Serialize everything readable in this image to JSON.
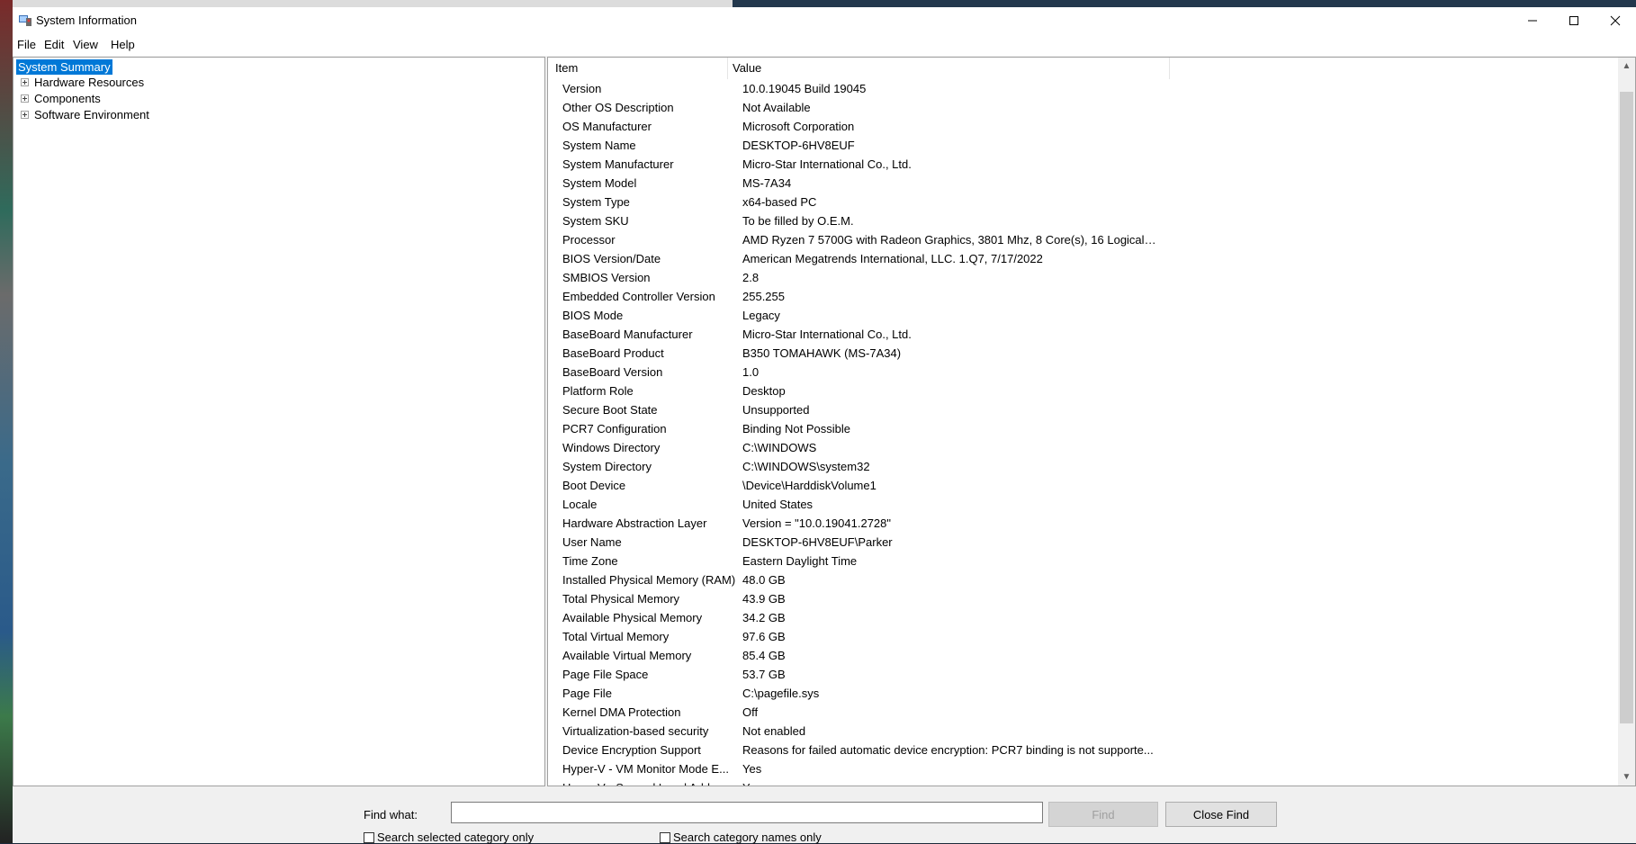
{
  "window": {
    "title": "System Information",
    "app_icon": "system-information-icon",
    "controls": [
      "minimize-icon",
      "maximize-icon",
      "close-icon"
    ]
  },
  "menu": [
    {
      "label": "File"
    },
    {
      "label": "Edit"
    },
    {
      "label": "View"
    },
    {
      "label": "Help"
    }
  ],
  "tree": {
    "selected": "System Summary",
    "items": [
      {
        "label": "Hardware Resources"
      },
      {
        "label": "Components"
      },
      {
        "label": "Software Environment"
      }
    ]
  },
  "list": {
    "columns": [
      "Item",
      "Value"
    ],
    "rows": [
      {
        "item": "Version",
        "value": "10.0.19045 Build 19045"
      },
      {
        "item": "Other OS Description",
        "value": "Not Available"
      },
      {
        "item": "OS Manufacturer",
        "value": "Microsoft Corporation"
      },
      {
        "item": "System Name",
        "value": "DESKTOP-6HV8EUF"
      },
      {
        "item": "System Manufacturer",
        "value": "Micro-Star International Co., Ltd."
      },
      {
        "item": "System Model",
        "value": "MS-7A34"
      },
      {
        "item": "System Type",
        "value": "x64-based PC"
      },
      {
        "item": "System SKU",
        "value": "To be filled by O.E.M."
      },
      {
        "item": "Processor",
        "value": "AMD Ryzen 7 5700G with Radeon Graphics, 3801 Mhz, 8 Core(s), 16 Logical P..."
      },
      {
        "item": "BIOS Version/Date",
        "value": "American Megatrends International, LLC. 1.Q7, 7/17/2022"
      },
      {
        "item": "SMBIOS Version",
        "value": "2.8"
      },
      {
        "item": "Embedded Controller Version",
        "value": "255.255"
      },
      {
        "item": "BIOS Mode",
        "value": "Legacy"
      },
      {
        "item": "BaseBoard Manufacturer",
        "value": "Micro-Star International Co., Ltd."
      },
      {
        "item": "BaseBoard Product",
        "value": "B350 TOMAHAWK (MS-7A34)"
      },
      {
        "item": "BaseBoard Version",
        "value": "1.0"
      },
      {
        "item": "Platform Role",
        "value": "Desktop"
      },
      {
        "item": "Secure Boot State",
        "value": "Unsupported"
      },
      {
        "item": "PCR7 Configuration",
        "value": "Binding Not Possible"
      },
      {
        "item": "Windows Directory",
        "value": "C:\\WINDOWS"
      },
      {
        "item": "System Directory",
        "value": "C:\\WINDOWS\\system32"
      },
      {
        "item": "Boot Device",
        "value": "\\Device\\HarddiskVolume1"
      },
      {
        "item": "Locale",
        "value": "United States"
      },
      {
        "item": "Hardware Abstraction Layer",
        "value": "Version = \"10.0.19041.2728\""
      },
      {
        "item": "User Name",
        "value": "DESKTOP-6HV8EUF\\Parker"
      },
      {
        "item": "Time Zone",
        "value": "Eastern Daylight Time"
      },
      {
        "item": "Installed Physical Memory (RAM)",
        "value": "48.0 GB"
      },
      {
        "item": "Total Physical Memory",
        "value": "43.9 GB"
      },
      {
        "item": "Available Physical Memory",
        "value": "34.2 GB"
      },
      {
        "item": "Total Virtual Memory",
        "value": "97.6 GB"
      },
      {
        "item": "Available Virtual Memory",
        "value": "85.4 GB"
      },
      {
        "item": "Page File Space",
        "value": "53.7 GB"
      },
      {
        "item": "Page File",
        "value": "C:\\pagefile.sys"
      },
      {
        "item": "Kernel DMA Protection",
        "value": "Off"
      },
      {
        "item": "Virtualization-based security",
        "value": "Not enabled"
      },
      {
        "item": "Device Encryption Support",
        "value": "Reasons for failed automatic device encryption: PCR7 binding is not supporte..."
      },
      {
        "item": "Hyper-V - VM Monitor Mode E...",
        "value": "Yes"
      },
      {
        "item": "Hyper-V - Second Level Addres...",
        "value": "Yes"
      }
    ]
  },
  "find": {
    "label": "Find what:",
    "value": "",
    "find_button": "Find",
    "close_button": "Close Find",
    "checkbox_selected": "Search selected category only",
    "checkbox_names": "Search category names only"
  }
}
